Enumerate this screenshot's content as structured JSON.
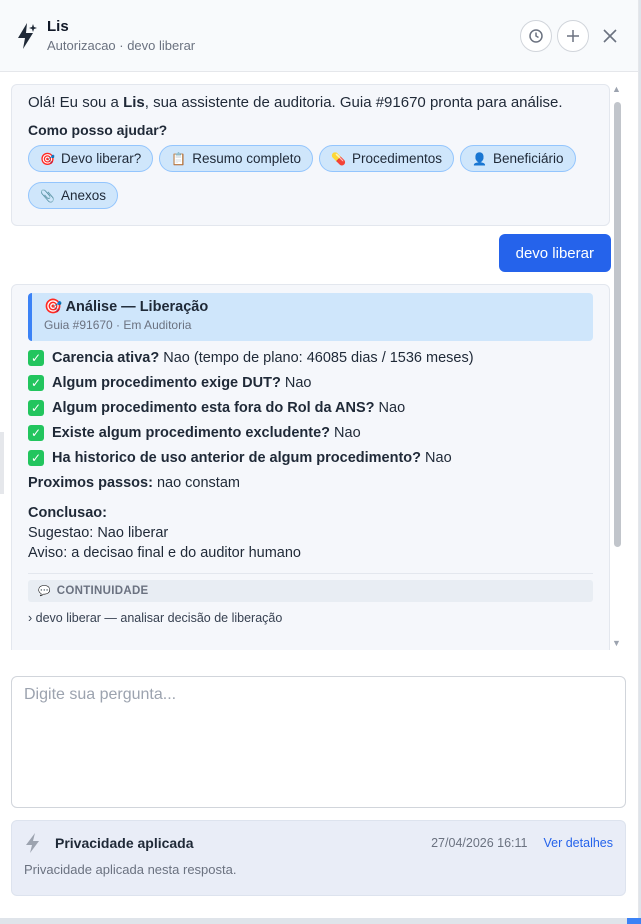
{
  "header": {
    "title": "Lis",
    "subtitle": "Autorizacao · devo liberar"
  },
  "intro": {
    "greeting_pre": "Olá! Eu sou a ",
    "greeting_name": "Lis",
    "greeting_post": ", sua assistente de auditoria. Guia #91670 pronta para análise.",
    "question": "Como posso ajudar?",
    "chips": [
      {
        "icon": "🎯",
        "label": "Devo liberar?"
      },
      {
        "icon": "📋",
        "label": "Resumo completo"
      },
      {
        "icon": "💊",
        "label": "Procedimentos"
      },
      {
        "icon": "👤",
        "label": "Beneficiário"
      },
      {
        "icon": "📎",
        "label": "Anexos"
      }
    ]
  },
  "user_message": "devo liberar",
  "analysis": {
    "icon": "🎯",
    "title": "Análise — Liberação",
    "subtitle": "Guia #91670 · Em Auditoria",
    "checks": [
      {
        "q": "Carencia ativa?",
        "a": " Nao (tempo de plano: 46085 dias / 1536 meses)"
      },
      {
        "q": "Algum procedimento exige DUT?",
        "a": " Nao"
      },
      {
        "q": "Algum procedimento esta fora do Rol da ANS?",
        "a": " Nao"
      },
      {
        "q": "Existe algum procedimento excludente?",
        "a": " Nao"
      },
      {
        "q": "Ha historico de uso anterior de algum procedimento?",
        "a": " Nao"
      }
    ],
    "next_label": "Proximos passos:",
    "next_value": " nao constam",
    "conclusion_label": "Conclusao:",
    "suggestion": "Sugestao: Nao liberar",
    "warning": "Aviso: a decisao final e do auditor humano",
    "continuity_icon": "💬",
    "continuity_label": "CONTINUIDADE",
    "continuity_item": "› devo liberar — analisar decisão de liberação"
  },
  "input": {
    "placeholder": "Digite sua pergunta..."
  },
  "privacy": {
    "title": "Privacidade aplicada",
    "timestamp": "27/04/2026 16:11",
    "link": "Ver detalhes",
    "description": "Privacidade aplicada nesta resposta."
  },
  "colors": {
    "accent": "#2563eb",
    "chip_bg": "#cfe6fb",
    "check_green": "#22c55e"
  }
}
